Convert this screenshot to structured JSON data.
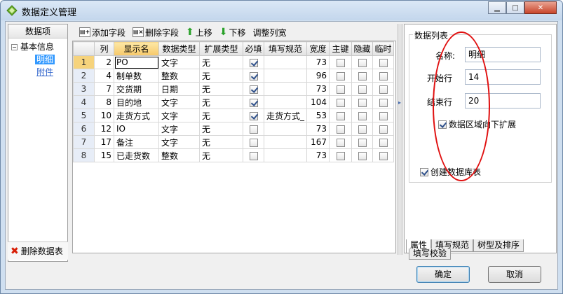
{
  "window": {
    "title": "数据定义管理"
  },
  "left_panel": {
    "header": "数据项",
    "tree": {
      "root": "基本信息",
      "toggle": "−",
      "children": [
        "明细",
        "附件"
      ]
    },
    "delete_label": "删除数据表"
  },
  "toolbar": {
    "add_label": "添加字段",
    "delete_label": "删除字段",
    "up_label": "上移",
    "down_label": "下移",
    "adjust_label": "调整列宽"
  },
  "grid": {
    "columns": [
      "列",
      "显示名",
      "数据类型",
      "扩展类型",
      "必填",
      "填写规范",
      "宽度",
      "主键",
      "隐藏",
      "临时"
    ],
    "rows": [
      {
        "n": "1",
        "col": "2",
        "name": "PO",
        "type": "文字",
        "ext": "无",
        "required": true,
        "rule": "",
        "width": "73",
        "pk": false,
        "hidden": false,
        "temp": false
      },
      {
        "n": "2",
        "col": "4",
        "name": "制单数",
        "type": "整数",
        "ext": "无",
        "required": true,
        "rule": "",
        "width": "96",
        "pk": false,
        "hidden": false,
        "temp": false
      },
      {
        "n": "3",
        "col": "7",
        "name": "交货期",
        "type": "日期",
        "ext": "无",
        "required": true,
        "rule": "",
        "width": "73",
        "pk": false,
        "hidden": false,
        "temp": false
      },
      {
        "n": "4",
        "col": "8",
        "name": "目的地",
        "type": "文字",
        "ext": "无",
        "required": true,
        "rule": "",
        "width": "104",
        "pk": false,
        "hidden": false,
        "temp": false
      },
      {
        "n": "5",
        "col": "10",
        "name": "走货方式",
        "type": "文字",
        "ext": "无",
        "required": true,
        "rule": "走货方式_",
        "width": "53",
        "pk": false,
        "hidden": false,
        "temp": false
      },
      {
        "n": "6",
        "col": "12",
        "name": "IO",
        "type": "文字",
        "ext": "无",
        "required": false,
        "rule": "",
        "width": "73",
        "pk": false,
        "hidden": false,
        "temp": false
      },
      {
        "n": "7",
        "col": "17",
        "name": "备注",
        "type": "文字",
        "ext": "无",
        "required": false,
        "rule": "",
        "width": "167",
        "pk": false,
        "hidden": false,
        "temp": false
      },
      {
        "n": "8",
        "col": "15",
        "name": "已走货数",
        "type": "整数",
        "ext": "无",
        "required": false,
        "rule": "",
        "width": "73",
        "pk": false,
        "hidden": false,
        "temp": false
      }
    ]
  },
  "properties": {
    "group_title": "数据列表",
    "name_label": "名称:",
    "name_value": "明细",
    "start_label": "开始行",
    "start_value": "14",
    "end_label": "结束行",
    "end_value": "20",
    "expand_label": "数据区域向下扩展",
    "expand_checked": true,
    "create_table_label": "创建数据库表",
    "create_table_checked": true
  },
  "tabs": [
    "属性",
    "填写规范",
    "树型及排序",
    "填写校验"
  ],
  "buttons": {
    "ok": "确定",
    "cancel": "取消"
  },
  "colors": {
    "accent": "#3399ff",
    "annotation": "#e01010"
  }
}
